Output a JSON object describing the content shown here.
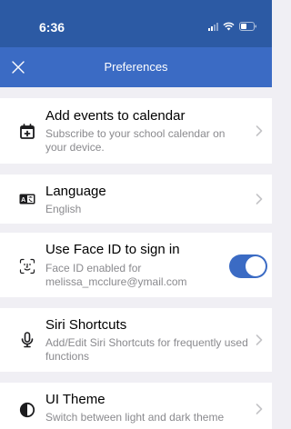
{
  "status_bar": {
    "time": "6:36"
  },
  "nav": {
    "title": "Preferences"
  },
  "rows": [
    {
      "title": "Add events to calendar",
      "subtitle": "Subscribe to your school calendar on your device."
    },
    {
      "title": "Language",
      "subtitle": "English"
    },
    {
      "title": "Use Face ID to sign in",
      "subtitle": "Face ID enabled for melissa_mcclure@ymail.com",
      "toggle_on": true
    },
    {
      "title": "Siri Shortcuts",
      "subtitle": "Add/Edit Siri Shortcuts for frequently used functions"
    },
    {
      "title": "UI Theme",
      "subtitle": "Switch between light and dark theme"
    }
  ],
  "colors": {
    "accent": "#3b6bc4",
    "status_bar": "#2c5aa4",
    "background": "#f0eff4"
  },
  "icons": [
    "close-icon",
    "calendar-add-icon",
    "language-icon",
    "face-id-icon",
    "microphone-icon",
    "contrast-icon",
    "chevron-right-icon"
  ]
}
